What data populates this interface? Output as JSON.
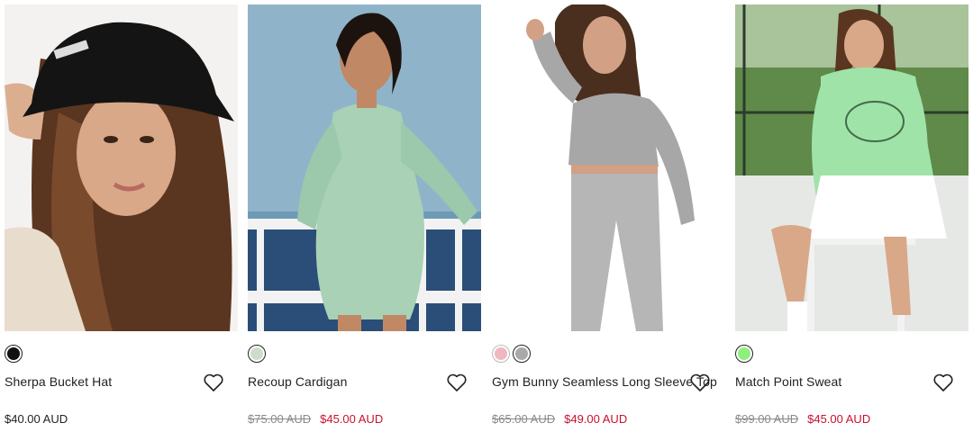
{
  "products": [
    {
      "name": "Sherpa Bucket Hat",
      "swatches": [
        {
          "color": "#111111"
        }
      ],
      "price": "$40.00 AUD",
      "sale_price": "",
      "image_icon": "product-photo-model-bucket-hat"
    },
    {
      "name": "Recoup Cardigan",
      "swatches": [
        {
          "color": "#cfdccb"
        }
      ],
      "original_price": "$75.00 AUD",
      "sale_price": "$45.00 AUD",
      "image_icon": "product-photo-model-cardigan"
    },
    {
      "name": "Gym Bunny Seamless Long Sleeve Top",
      "swatches": [
        {
          "color": "#f0b7c1"
        },
        {
          "color": "#a9a9a9"
        }
      ],
      "original_price": "$65.00 AUD",
      "sale_price": "$49.00 AUD",
      "image_icon": "product-photo-model-long-sleeve-top"
    },
    {
      "name": "Match Point Sweat",
      "swatches": [
        {
          "color": "#8ef07c"
        }
      ],
      "original_price": "$99.00 AUD",
      "sale_price": "$45.00 AUD",
      "image_icon": "product-photo-model-sweat"
    }
  ],
  "colors": {
    "sale": "#c8102e",
    "strike": "#8a8a8a",
    "text": "#222222"
  },
  "icons": {
    "wishlist": "heart-icon"
  }
}
